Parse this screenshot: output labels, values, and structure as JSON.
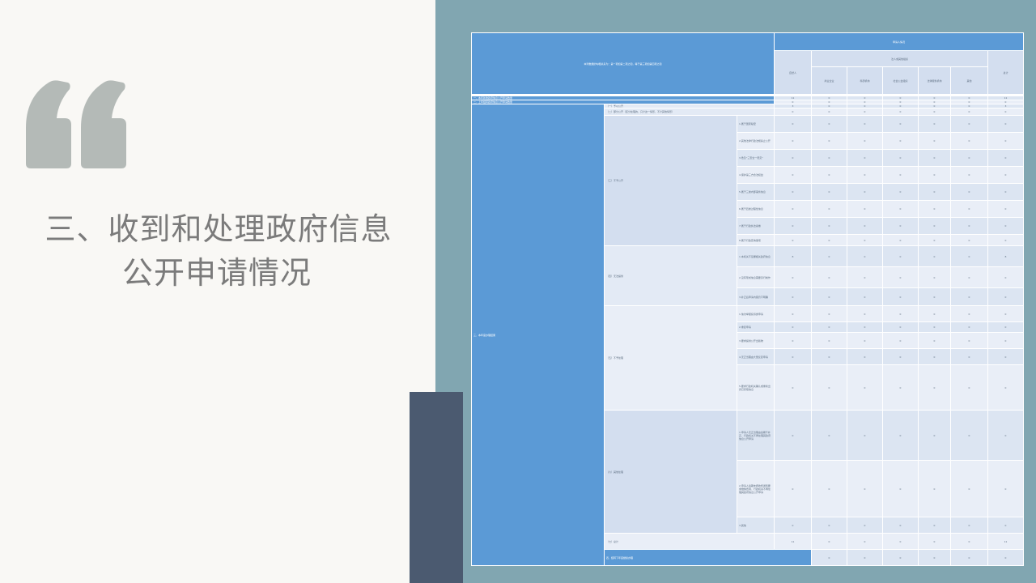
{
  "slide": {
    "title_line1": "三、收到和处理政府信息",
    "title_line2": "公开申请情况",
    "colors": {
      "background": "#f9f8f5",
      "right_panel": "#81a6b1",
      "dark_block": "#4b5a70",
      "quote_mark": "#b4bab7",
      "table_header": "#5b9ad6",
      "table_cell": "#dce5f2",
      "table_cell_alt": "#e9eef7"
    },
    "icons": {
      "quote": "left-double-quote-icon"
    }
  },
  "table": {
    "corner_header": "本列数据的勾稽关系为：第一项加第二项之和，等于第三项加第四项之和",
    "group_header": "申请人情况",
    "natural_person": "自然人",
    "legal_group": "法人或其他组织",
    "legal_cols": [
      "商业企业",
      "科研机构",
      "社会公益组织",
      "法律服务机构",
      "其他"
    ],
    "total": "总计",
    "row1_label": "一、本年新收政府信息公开申请数量",
    "row2_label": "二、上年结转政府信息公开申请数量",
    "row3_label": "三、本年度办理结果",
    "row4_label": "四、结转下年度继续办理",
    "r1_values": [
      "11",
      "0",
      "0",
      "0",
      "0",
      "0",
      "11"
    ],
    "r2_values": [
      "0",
      "0",
      "0",
      "0",
      "0",
      "0",
      "0"
    ],
    "sec1": "（一）予以公开",
    "sec1_values": [
      "3",
      "0",
      "0",
      "0",
      "0",
      "0",
      "3"
    ],
    "sec2": "（二）部分公开（区分处理的，只计这一情形，不计其他情形）",
    "sec2_values": [
      "0",
      "0",
      "0",
      "0",
      "0",
      "0",
      "0"
    ],
    "sec3": "（三）不予公开",
    "sec3_items": [
      {
        "label": "1.属于国家秘密",
        "values": [
          "0",
          "0",
          "0",
          "0",
          "0",
          "0",
          "0"
        ]
      },
      {
        "label": "2.其他法律行政法规禁止公开",
        "values": [
          "0",
          "0",
          "0",
          "0",
          "0",
          "0",
          "0"
        ]
      },
      {
        "label": "3.危及“三安全一稳定”",
        "values": [
          "0",
          "0",
          "0",
          "0",
          "0",
          "0",
          "0"
        ]
      },
      {
        "label": "4.保护第三方合法权益",
        "values": [
          "0",
          "0",
          "0",
          "0",
          "0",
          "0",
          "0"
        ]
      },
      {
        "label": "5.属于三类内部事务信息",
        "values": [
          "0",
          "0",
          "0",
          "0",
          "0",
          "0",
          "0"
        ]
      },
      {
        "label": "6.属于四类过程性信息",
        "values": [
          "0",
          "0",
          "0",
          "0",
          "0",
          "0",
          "0"
        ]
      },
      {
        "label": "7.属于行政执法案卷",
        "values": [
          "0",
          "0",
          "0",
          "0",
          "0",
          "0",
          "0"
        ]
      },
      {
        "label": "8.属于行政查询事项",
        "values": [
          "0",
          "0",
          "0",
          "0",
          "0",
          "0",
          "0"
        ]
      }
    ],
    "sec4": "（四）无法提供",
    "sec4_items": [
      {
        "label": "1.本机关不掌握相关政府信息",
        "values": [
          "8",
          "0",
          "0",
          "0",
          "0",
          "0",
          "8"
        ]
      },
      {
        "label": "2.没有现成信息需要另行制作",
        "values": [
          "0",
          "0",
          "0",
          "0",
          "0",
          "0",
          "0"
        ]
      },
      {
        "label": "3.补正后申请内容仍不明确",
        "values": [
          "0",
          "0",
          "0",
          "0",
          "0",
          "0",
          "0"
        ]
      }
    ],
    "sec5": "（五）不予处理",
    "sec5_items": [
      {
        "label": "1.信访举报投诉类申请",
        "values": [
          "0",
          "0",
          "0",
          "0",
          "0",
          "0",
          "0"
        ]
      },
      {
        "label": "2.重复申请",
        "values": [
          "0",
          "0",
          "0",
          "0",
          "0",
          "0",
          "0"
        ]
      },
      {
        "label": "3.要求提供公开出版物",
        "values": [
          "0",
          "0",
          "0",
          "0",
          "0",
          "0",
          "0"
        ]
      },
      {
        "label": "4.无正当理由大量反复申请",
        "values": [
          "0",
          "0",
          "0",
          "0",
          "0",
          "0",
          "0"
        ]
      },
      {
        "label": "5.要求行政机关确认或重新出具已获取信息",
        "values": [
          "0",
          "0",
          "0",
          "0",
          "0",
          "0",
          "0"
        ]
      }
    ],
    "sec6": "（六）其他处理",
    "sec6_items": [
      {
        "label": "1.申请人无正当理由逾期不补正、行政机关不再处理其政府信息公开申请",
        "values": [
          "0",
          "0",
          "0",
          "0",
          "0",
          "0",
          "0"
        ]
      },
      {
        "label": "2.申请人逾期未按收费通知要求缴纳费用、行政机关不再处理其政府信息公开申请",
        "values": [
          "0",
          "0",
          "0",
          "0",
          "0",
          "0",
          "0"
        ]
      },
      {
        "label": "3.其他",
        "values": [
          "0",
          "0",
          "0",
          "0",
          "0",
          "0",
          "0"
        ]
      }
    ],
    "sec7": "（七）总计",
    "sec7_values": [
      "11",
      "0",
      "0",
      "0",
      "0",
      "0",
      "11"
    ],
    "r4_values": [
      "0",
      "0",
      "0",
      "0",
      "0",
      "0",
      "0"
    ]
  }
}
